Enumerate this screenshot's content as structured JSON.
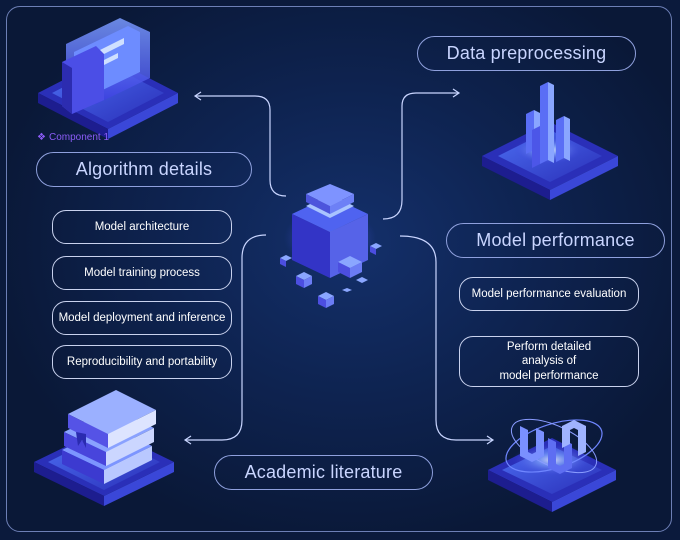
{
  "component_label": "Component 1",
  "component_icon": "component-diamond-icon",
  "top_left_title": "Algorithm details",
  "top_right_title": "Data preprocessing",
  "right_title": "Model performance",
  "bottom_title": "Academic literature",
  "algorithm_items": [
    "Model architecture",
    "Model training process",
    "Model deployment and inference",
    "Reproducibility and portability"
  ],
  "performance_items": {
    "evaluation": "Model performance evaluation",
    "analysis_line1": "Perform detailed",
    "analysis_line2": "analysis of",
    "analysis_line3": "model performance"
  },
  "icons": {
    "document": "document-stack-icon",
    "chart": "bar-chart-icon",
    "center": "data-cube-icon",
    "books": "books-icon",
    "atom": "atom-u-icon"
  },
  "colors": {
    "background": "#0b1a3c",
    "accent": "#5a5ef7",
    "text": "#c9d5ff",
    "component_label": "#8b5cf6"
  }
}
